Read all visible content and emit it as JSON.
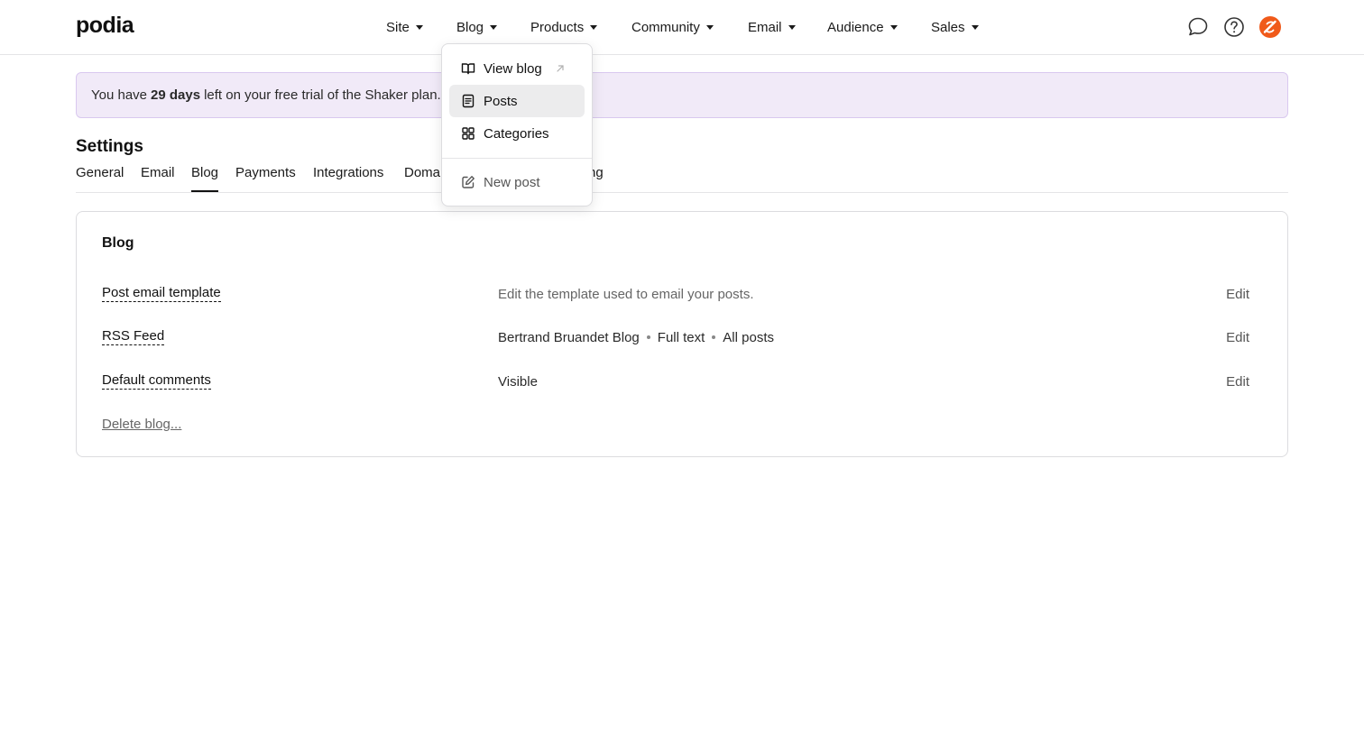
{
  "app": {
    "logo": "podia",
    "nav": [
      "Site",
      "Blog",
      "Products",
      "Community",
      "Email",
      "Audience",
      "Sales"
    ],
    "icons": [
      "chat-bubble-icon",
      "help-icon",
      "avatar-icon"
    ],
    "avatar_color": "#f05a1a"
  },
  "banner": {
    "prefix": "You have",
    "days": "29 days",
    "suffix": "left on your free trial of the Shaker plan."
  },
  "settings": {
    "title": "Settings",
    "tabs": [
      "General",
      "Email",
      "Blog",
      "Payments",
      "Integrations",
      "Domai",
      "ng"
    ],
    "active_tab": "Blog"
  },
  "card": {
    "title": "Blog",
    "rows": [
      {
        "label": "Post email template",
        "value": "Edit the template used to email your posts.",
        "action": "Edit"
      },
      {
        "label": "RSS Feed",
        "values": [
          "Bertrand Bruandet Blog",
          "Full text",
          "All posts"
        ],
        "action": "Edit"
      },
      {
        "label": "Default comments",
        "value": "Visible",
        "action": "Edit"
      }
    ],
    "delete_link": "Delete blog..."
  },
  "dropdown": {
    "items": [
      {
        "label": "View blog",
        "icon": "book-open-icon",
        "external": true
      },
      {
        "label": "Posts",
        "icon": "document-icon",
        "highlighted": true
      },
      {
        "label": "Categories",
        "icon": "grid-icon"
      },
      {
        "label": "New post",
        "icon": "edit-icon"
      }
    ]
  }
}
